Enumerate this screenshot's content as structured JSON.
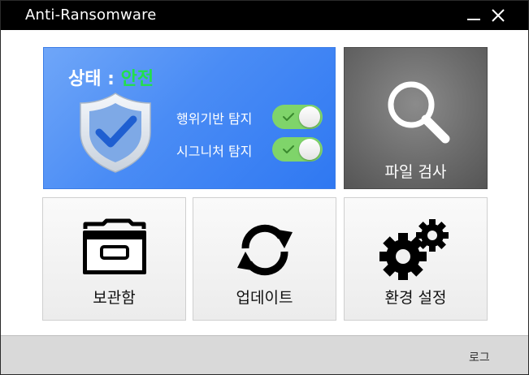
{
  "window": {
    "title": "Anti-Ransomware",
    "minimize_icon": "minimize-icon",
    "close_icon": "close-icon"
  },
  "status": {
    "label": "상태 : ",
    "value": "안전",
    "value_color": "#22e04a",
    "shield_icon": "shield-check-icon",
    "toggles": [
      {
        "label": "행위기반 탐지",
        "enabled": true
      },
      {
        "label": "시그니처 탐지",
        "enabled": true
      }
    ]
  },
  "scan": {
    "label": "파일 검사",
    "icon": "magnifier-icon"
  },
  "menu": {
    "vault_label": "보관함",
    "vault_icon": "drawer-icon",
    "update_label": "업데이트",
    "update_icon": "refresh-icon",
    "settings_label": "환경 설정",
    "settings_icon": "gears-icon"
  },
  "footer": {
    "log_label": "로그"
  },
  "colors": {
    "status_blue": "#4a8cf5",
    "toggle_green": "#7fd46a",
    "scan_gray": "#6c6c6c",
    "titlebar": "#000000"
  }
}
